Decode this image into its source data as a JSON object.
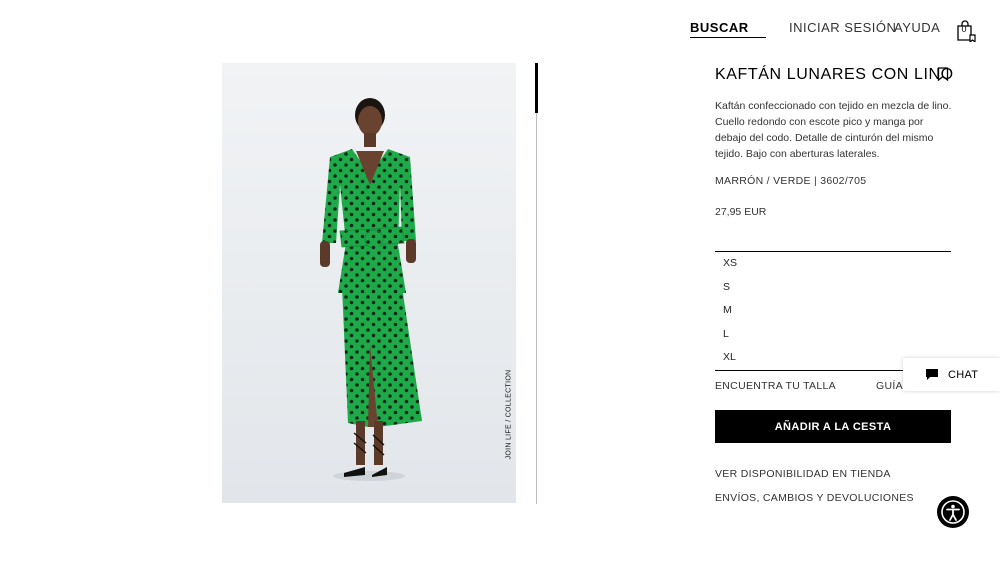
{
  "header": {
    "search_label": "BUSCAR",
    "login_label": "INICIAR SESIÓN",
    "help_label": "AYUDA",
    "cart_count": "0"
  },
  "product": {
    "image_tag": "JOIN LIFE / COLLECTION",
    "image_icon": "green-polka-dot-kaftan-photo",
    "title": "KAFTÁN LUNARES CON LINO",
    "description": "Kaftán confeccionado con tejido en mezcla de lino. Cuello redondo con escote pico y manga por debajo del codo. Detalle de cinturón del mismo tejido. Bajo con aberturas laterales.",
    "color_ref": "MARRÓN / VERDE | 3602/705",
    "price": "27,95 EUR",
    "sizes": [
      "XS",
      "S",
      "M",
      "L",
      "XL"
    ],
    "find_size_label": "ENCUENTRA TU TALLA",
    "guide_label": "GUÍA",
    "add_to_cart_label": "AÑADIR A LA CESTA",
    "store_availability_label": "VER DISPONIBILIDAD EN TIENDA",
    "shipping_label": "ENVÍOS, CAMBIOS Y DEVOLUCIONES"
  },
  "chat": {
    "label": "CHAT",
    "icon": "chat-bubble-icon"
  },
  "accessibility": {
    "icon": "accessibility-icon"
  },
  "colors": {
    "accent": "#000000",
    "dress_green": "#1faa4a",
    "background": "#ffffff"
  }
}
